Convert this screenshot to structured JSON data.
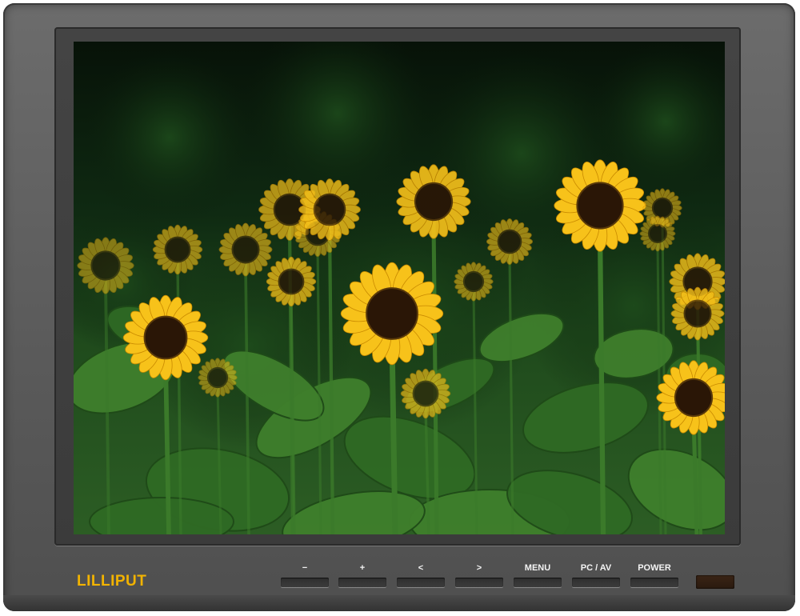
{
  "device": {
    "brand": "LILLIPUT",
    "screen_content": "sunflower-field-image"
  },
  "controls": {
    "buttons": [
      {
        "id": "minus",
        "label": "−"
      },
      {
        "id": "plus",
        "label": "+"
      },
      {
        "id": "left",
        "label": "<"
      },
      {
        "id": "right",
        "label": ">"
      },
      {
        "id": "menu",
        "label": "MENU"
      },
      {
        "id": "pcav",
        "label": "PC / AV"
      },
      {
        "id": "power",
        "label": "POWER"
      }
    ]
  },
  "colors": {
    "bezel": "#5b5b5b",
    "brand": "#f2b300",
    "petal": "#f7c21a",
    "center": "#2a1606",
    "leaf": "#3f7f2c"
  }
}
